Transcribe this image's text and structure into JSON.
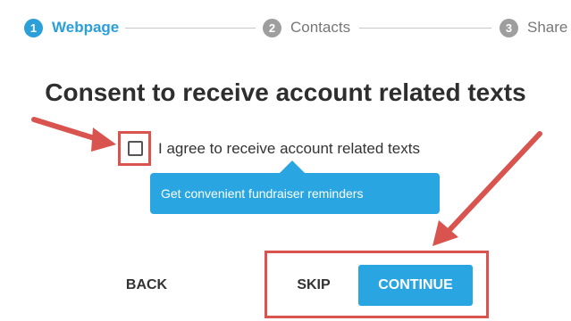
{
  "stepper": {
    "steps": [
      {
        "number": "1",
        "label": "Webpage",
        "state": "active"
      },
      {
        "number": "2",
        "label": "Contacts",
        "state": "inactive"
      },
      {
        "number": "3",
        "label": "Share",
        "state": "inactive"
      }
    ]
  },
  "main": {
    "title": "Consent to receive account related texts",
    "checkbox": {
      "label": "I agree to receive account related texts",
      "checked": false
    },
    "tooltip": "Get convenient fundraiser reminders"
  },
  "actions": {
    "back_label": "BACK",
    "skip_label": "SKIP",
    "continue_label": "CONTINUE"
  },
  "colors": {
    "accent": "#29a6e2",
    "annotation": "#d9534f",
    "inactive_step": "#9e9e9e"
  }
}
